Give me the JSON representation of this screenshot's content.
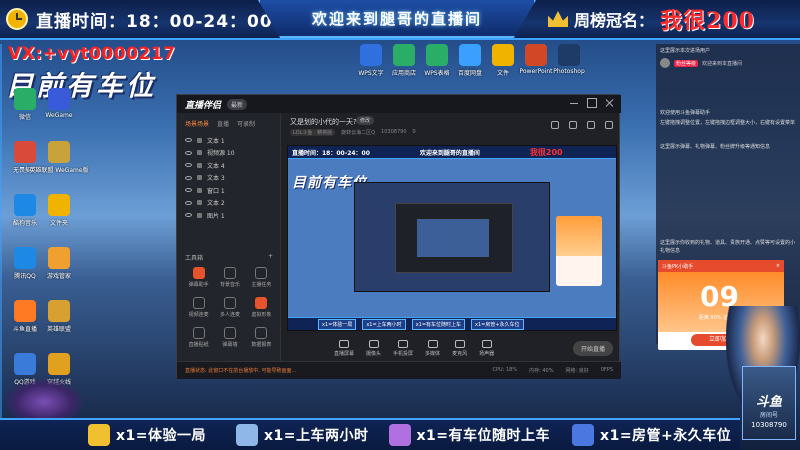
{
  "top": {
    "live_time_label": "直播时间：18：00-24：00",
    "welcome": "欢迎来到腿哥的直播间",
    "rank_label": "周榜冠名：",
    "rank_name": "我很200"
  },
  "overlay": {
    "vx": "VX:+vyt0000217",
    "car_status": "目前有车位"
  },
  "desktop_left": [
    {
      "label": "微信",
      "color": "#2aae67"
    },
    {
      "label": "WeGame",
      "color": "#3a5bd9"
    },
    {
      "label": "无畏契约",
      "color": "#d94a3a"
    },
    {
      "label": "英雄联盟 WeGame版",
      "color": "#c8a23a"
    },
    {
      "label": "酷狗音乐",
      "color": "#1e88e5"
    },
    {
      "label": "文件夹",
      "color": "#f0b400"
    },
    {
      "label": "腾讯QQ",
      "color": "#1e88e5"
    },
    {
      "label": "游戏管家",
      "color": "#f0a030"
    },
    {
      "label": "斗鱼直播",
      "color": "#ff7a22"
    },
    {
      "label": "英雄联盟",
      "color": "#d8a030"
    },
    {
      "label": "QQ游戏",
      "color": "#3a7ad9"
    },
    {
      "label": "穿越火线",
      "color": "#e0a020"
    }
  ],
  "desktop_top": [
    {
      "label": "WPS文字",
      "color": "#2f6fde"
    },
    {
      "label": "应用商店",
      "color": "#2aae67"
    },
    {
      "label": "WPS表格",
      "color": "#2aae67"
    },
    {
      "label": "百度网盘",
      "color": "#3aa0ff"
    },
    {
      "label": "文件",
      "color": "#f0b400"
    },
    {
      "label": "PowerPoint",
      "color": "#d24726"
    },
    {
      "label": "Photoshop",
      "color": "#1e3a66"
    }
  ],
  "app": {
    "logo": "直播伴侣",
    "version": "最新",
    "tabs": [
      "场景场景",
      "直播",
      "可录制"
    ],
    "scenes": [
      "文本 1",
      "视频源 10",
      "文本 4",
      "文本 3",
      "窗口 1",
      "文本 2",
      "图片 1"
    ],
    "tools_label": "工具箱",
    "tools": [
      {
        "label": "弹幕助手",
        "color": "#e6542e"
      },
      {
        "label": "背景音乐",
        "color": "#777"
      },
      {
        "label": "主播任务",
        "color": "#777"
      },
      {
        "label": "视频连麦",
        "color": "#777"
      },
      {
        "label": "多人连麦",
        "color": "#777"
      },
      {
        "label": "虚拟形象",
        "color": "#e6542e"
      },
      {
        "label": "直播贴纸",
        "color": "#777"
      },
      {
        "label": "弹幕墙",
        "color": "#777"
      },
      {
        "label": "数据报表",
        "color": "#777"
      }
    ],
    "room_title": "又是划的小代的一天?",
    "edit": "修改",
    "room_meta": [
      "LOL斗鱼 · 精英版",
      "旋转云海二区Q",
      "10308790",
      "0"
    ],
    "controls": [
      "直播屏幕",
      "摄像头",
      "手机投屏",
      "多媒体",
      "麦克风",
      "扬声器"
    ],
    "start_btn": "开始直播",
    "status_warn": "直播状态: 此窗口不在前台播放中, 可能导致画面...",
    "status_right": [
      "CPU: 18%",
      "内存: 40%",
      "网络: 良好",
      "0FPS"
    ]
  },
  "preview": {
    "bar_clock": "直播时间：18：00-24：00",
    "bar_welcome": "欢迎来到腿哥的直播间",
    "bar_rank": "我很200",
    "big": "目前有车位",
    "bottom": [
      "x1=体验一局",
      "x1=上车两小时",
      "x1=有车位随时上车",
      "x1=房管+永久车位"
    ]
  },
  "chat": {
    "title": "这里展示本次进场用户",
    "user": "新来的小兵",
    "level": "粉丝等级",
    "welcome": "欢迎来到本直播间",
    "msg1": "欢迎使用斗鱼弹幕助手",
    "msg2": "左键拖拽调整位置，左键拖拽边框调整大小，右键有设置菜单",
    "msg3": "这里展示弹幕、礼物弹幕、粉丝牌升级等通知信息",
    "msg4": "这里展示你收到的礼物、道具、贵族开通、点赞等可设置的小礼物信息"
  },
  "promo": {
    "head": "斗鱼PK小助手",
    "num": "09",
    "sub": "距离 90% 达成进度",
    "btn": "立即加速"
  },
  "mascot": {
    "brand": "斗鱼",
    "sub": "房间号",
    "room_id": "10308790"
  },
  "rewards": [
    {
      "label": "x1=体验一局",
      "color": "#f0c030"
    },
    {
      "label": "x1=上车两小时",
      "color": "#8fb8e8"
    },
    {
      "label": "x1=有车位随时上车",
      "color": "#b070e0"
    },
    {
      "label": "x1=房管+永久车位",
      "color": "#4a78e0"
    }
  ]
}
